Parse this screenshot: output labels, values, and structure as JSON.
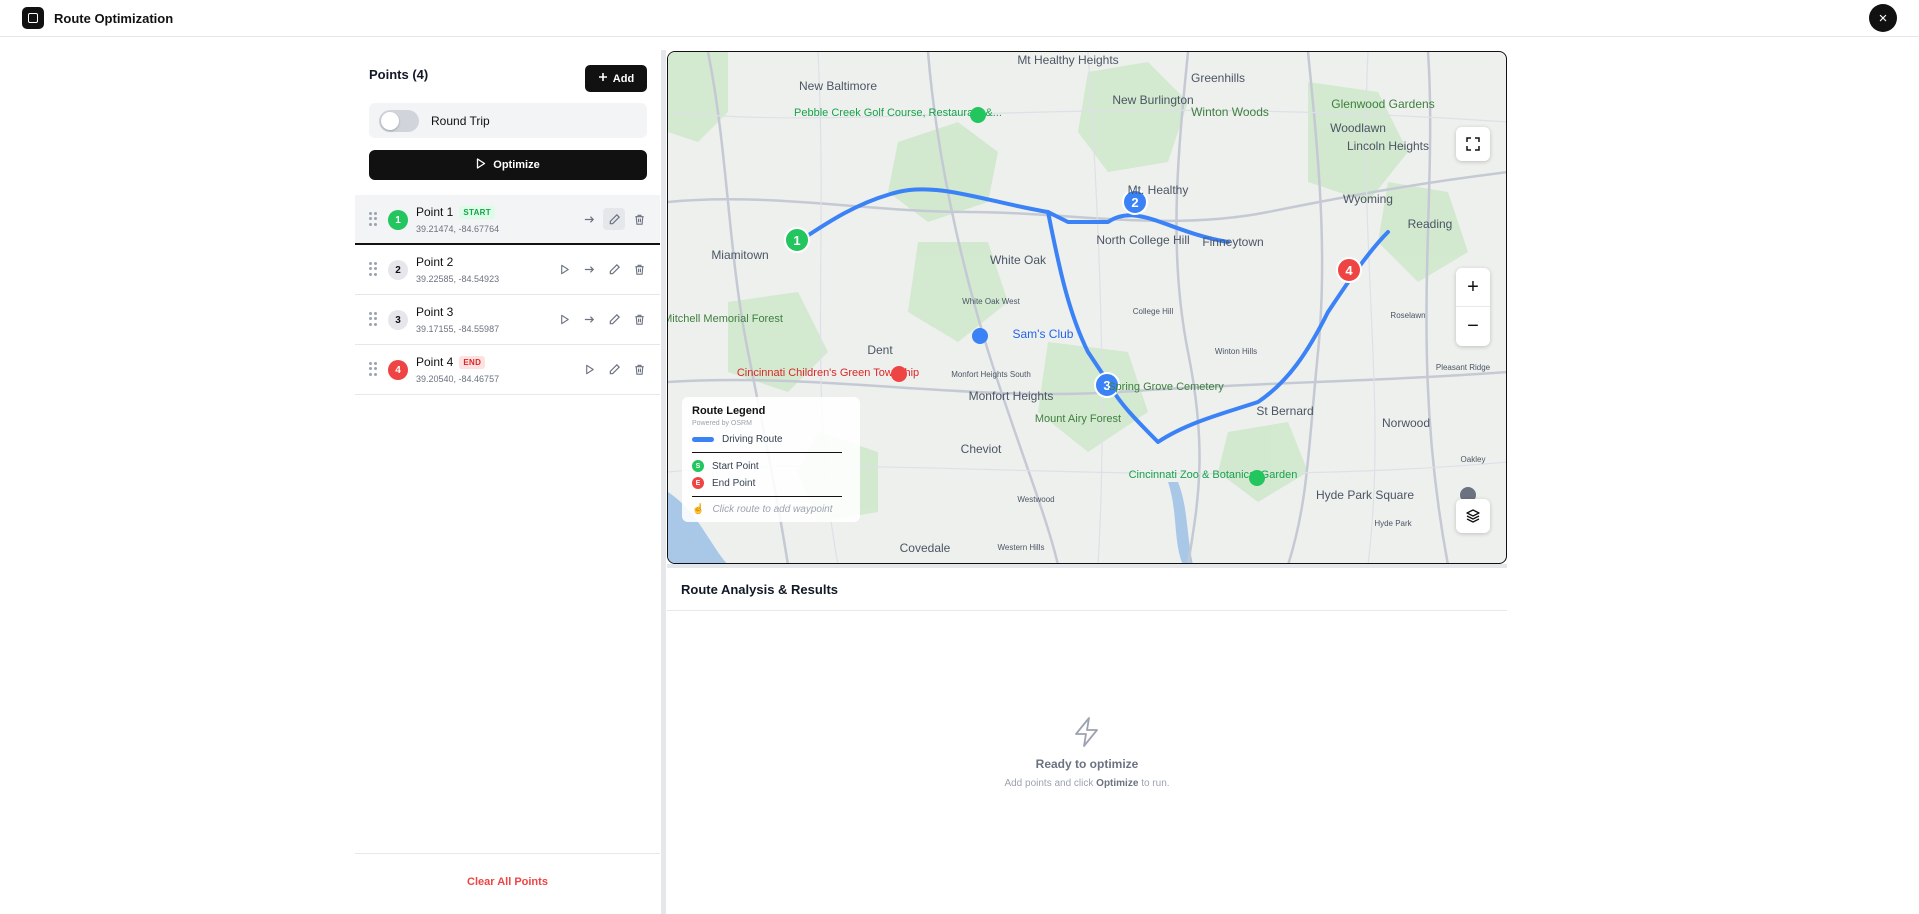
{
  "app": {
    "title": "Route Optimization",
    "close_label": "×"
  },
  "points_panel": {
    "heading": "Points (4)",
    "add_label": "Add",
    "round_trip_label": "Round Trip",
    "round_trip_on": false,
    "optimize_label": "Optimize",
    "clear_label": "Clear All Points",
    "points": [
      {
        "number": "1",
        "name": "Point 1",
        "tag": "START",
        "coords": "39.21474, -84.67764",
        "role": "start"
      },
      {
        "number": "2",
        "name": "Point 2",
        "tag": "",
        "coords": "39.22585, -84.54923",
        "role": "mid"
      },
      {
        "number": "3",
        "name": "Point 3",
        "tag": "",
        "coords": "39.17155, -84.55987",
        "role": "mid"
      },
      {
        "number": "4",
        "name": "Point 4",
        "tag": "END",
        "coords": "39.20540, -84.46757",
        "role": "end"
      }
    ]
  },
  "map": {
    "place_labels": [
      "Mt Healthy Heights",
      "New Baltimore",
      "Greenhills",
      "New Burlington",
      "Winton Woods",
      "Glenwood Gardens",
      "Pebble Creek Golf Course, Restaurant &...",
      "Woodlawn",
      "Lincoln Heights",
      "Mt. Healthy",
      "Wyoming",
      "Reading",
      "North College Hill",
      "Finneytown",
      "Miamitown",
      "White Oak",
      "Mitchell Memorial Forest",
      "Dent",
      "Sam's Club",
      "College Hill",
      "White Oak West",
      "Roselawn",
      "Winton Hills",
      "Pleasant Ridge",
      "Cincinnati Children's Green Township",
      "Monfort Heights South",
      "Monfort Heights",
      "Spring Grove Cemetery",
      "St Bernard",
      "Norwood",
      "Mount Airy Forest",
      "Cheviot",
      "Cincinnati Zoo & Botanical Garden",
      "Oakley",
      "Hyde Park Square",
      "Westwood",
      "Hyde Park",
      "Covedale",
      "Western Hills"
    ],
    "markers": [
      "1",
      "2",
      "3",
      "4"
    ],
    "zoom_in": "+",
    "zoom_out": "−",
    "route_color": "#3b82f6",
    "legend": {
      "title": "Route Legend",
      "powered": "Powered by OSRM",
      "driving": "Driving Route",
      "start": "Start Point",
      "start_badge": "S",
      "end": "End Point",
      "end_badge": "E",
      "hint": "Click route to add waypoint"
    }
  },
  "results": {
    "title": "Route Analysis & Results",
    "empty_title": "Ready to optimize",
    "empty_pre": "Add points and click",
    "empty_bold": "Optimize",
    "empty_post": "to run."
  },
  "colors": {
    "start": "#22c55e",
    "end": "#ef4444",
    "accent": "#111111",
    "danger": "#ef4444"
  }
}
